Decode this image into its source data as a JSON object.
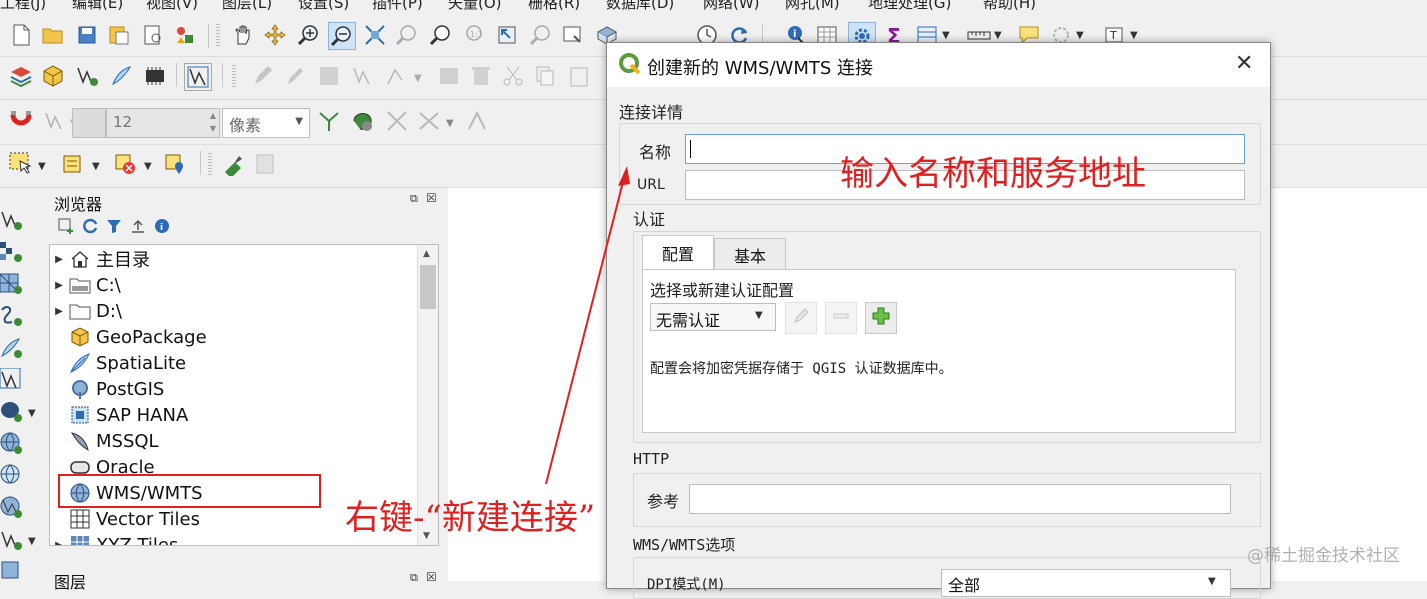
{
  "menubar": {
    "items": [
      "工程(J)",
      "编辑(E)",
      "视图(V)",
      "图层(L)",
      "设置(S)",
      "插件(P)",
      "矢量(O)",
      "栅格(R)",
      "数据库(D)",
      "网络(W)",
      "网孔(M)",
      "地理处理(G)",
      "帮助(H)"
    ]
  },
  "toolbar3": {
    "spin_value": "12",
    "unit_value": "像素"
  },
  "browser": {
    "title": "浏览器",
    "items": [
      {
        "label": "主目录",
        "icon": "home-icon",
        "expandable": true
      },
      {
        "label": "C:\\",
        "icon": "drive-icon",
        "expandable": true
      },
      {
        "label": "D:\\",
        "icon": "folder-icon",
        "expandable": true
      },
      {
        "label": "GeoPackage",
        "icon": "geopackage-icon",
        "expandable": false
      },
      {
        "label": "SpatiaLite",
        "icon": "spatialite-icon",
        "expandable": false
      },
      {
        "label": "PostGIS",
        "icon": "postgis-elephant-icon",
        "expandable": false
      },
      {
        "label": "SAP HANA",
        "icon": "sap-hana-icon",
        "expandable": false
      },
      {
        "label": "MSSQL",
        "icon": "mssql-icon",
        "expandable": false
      },
      {
        "label": "Oracle",
        "icon": "oracle-icon",
        "expandable": false
      },
      {
        "label": "WMS/WMTS",
        "icon": "globe-icon",
        "expandable": false
      },
      {
        "label": "Vector Tiles",
        "icon": "vector-tiles-icon",
        "expandable": false
      },
      {
        "label": "XYZ Tiles",
        "icon": "xyz-tiles-icon",
        "expandable": true
      }
    ],
    "next_panel_title": "图层"
  },
  "dialog": {
    "title": "创建新的 WMS/WMTS 连接",
    "connection_group": "连接详情",
    "name_label": "名称",
    "name_value": "",
    "url_label": "URL",
    "url_value": "",
    "auth_group": "认证",
    "tabs": [
      "配置",
      "基本"
    ],
    "auth_select_label": "选择或新建认证配置",
    "auth_combo_value": "无需认证",
    "auth_note": "配置会将加密凭据存储于 QGIS 认证数据库中。",
    "http_group": "HTTP",
    "referer_label": "参考",
    "referer_value": "",
    "options_group": "WMS/WMTS选项",
    "dpi_label": "DPI模式(M)",
    "dpi_value": "全部"
  },
  "annotations": {
    "top": "输入名称和服务地址",
    "bottom": "右键-“新建连接”",
    "color": "#e02020"
  },
  "watermark": "@稀土掘金技术社区"
}
